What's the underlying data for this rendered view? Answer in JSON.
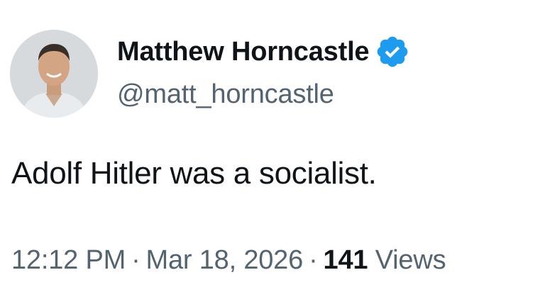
{
  "author": {
    "display_name": "Matthew Horncastle",
    "handle": "@matt_horncastle",
    "verified_icon": "verified-badge-icon",
    "verified_color": "#1d9bf0"
  },
  "tweet": {
    "text": "Adolf Hitler was a socialist."
  },
  "meta": {
    "time": "12:12 PM",
    "separator": "·",
    "date": "Mar 18, 2026",
    "views_count": "141",
    "views_label": "Views"
  },
  "colors": {
    "primary_text": "#0f1419",
    "secondary_text": "#536471",
    "background": "#ffffff"
  }
}
